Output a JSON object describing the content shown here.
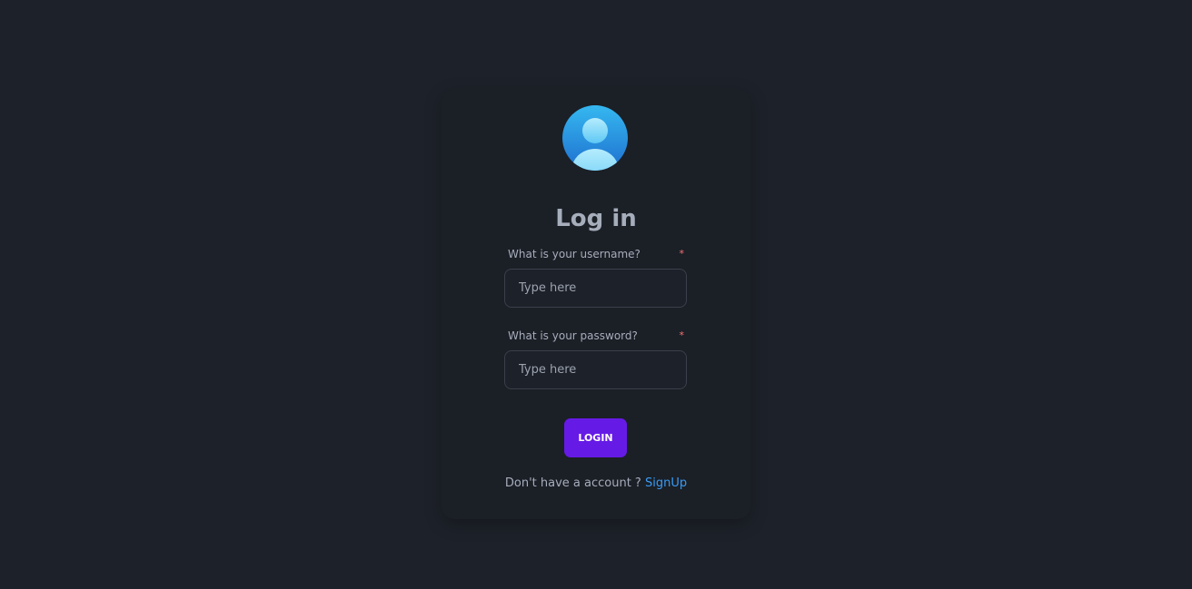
{
  "login": {
    "title": "Log in",
    "avatar_icon": "user-avatar-icon",
    "username": {
      "label": "What is your username?",
      "required_mark": "*",
      "placeholder": "Type here",
      "value": ""
    },
    "password": {
      "label": "What is your password?",
      "required_mark": "*",
      "placeholder": "Type here",
      "value": ""
    },
    "login_button": "LOGIN",
    "signup_prompt": "Don't have a account ?",
    "signup_link": "SignUp"
  },
  "colors": {
    "background": "#1d2129",
    "card": "#1b1f26",
    "primary": "#661ae6",
    "link": "#3a9bf4",
    "required": "#f87272",
    "text": "#a6adbb"
  }
}
